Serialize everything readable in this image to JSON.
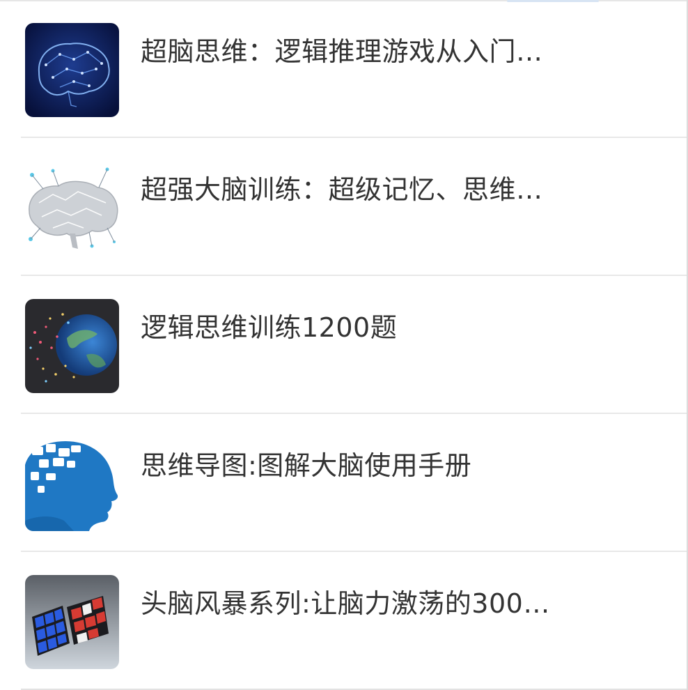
{
  "list": {
    "items": [
      {
        "title": "超脑思维：逻辑推理游戏从入门…",
        "cover_icon": "brain-network-cover-icon"
      },
      {
        "title": "超强大脑训练：超级记忆、思维…",
        "cover_icon": "lowpoly-brain-cover-icon"
      },
      {
        "title": "逻辑思维训练1200题",
        "cover_icon": "globe-particles-cover-icon"
      },
      {
        "title": "思维导图:图解大脑使用手册",
        "cover_icon": "head-puzzle-cover-icon"
      },
      {
        "title": "头脑风暴系列:让脑力激荡的300…",
        "cover_icon": "rubiks-cube-cover-icon"
      }
    ]
  },
  "colors": {
    "text": "#333333",
    "divider": "#e8e8e8",
    "background": "#ffffff",
    "brain_cover_bg": "#0b1648",
    "brain_cover_glow": "#7fb3ff",
    "lowpoly_gray": "#c9ccd1",
    "globe_blue": "#2b69b8",
    "head_blue": "#1f78c4",
    "cube_blue": "#2058d8",
    "cube_red": "#d63b33"
  }
}
